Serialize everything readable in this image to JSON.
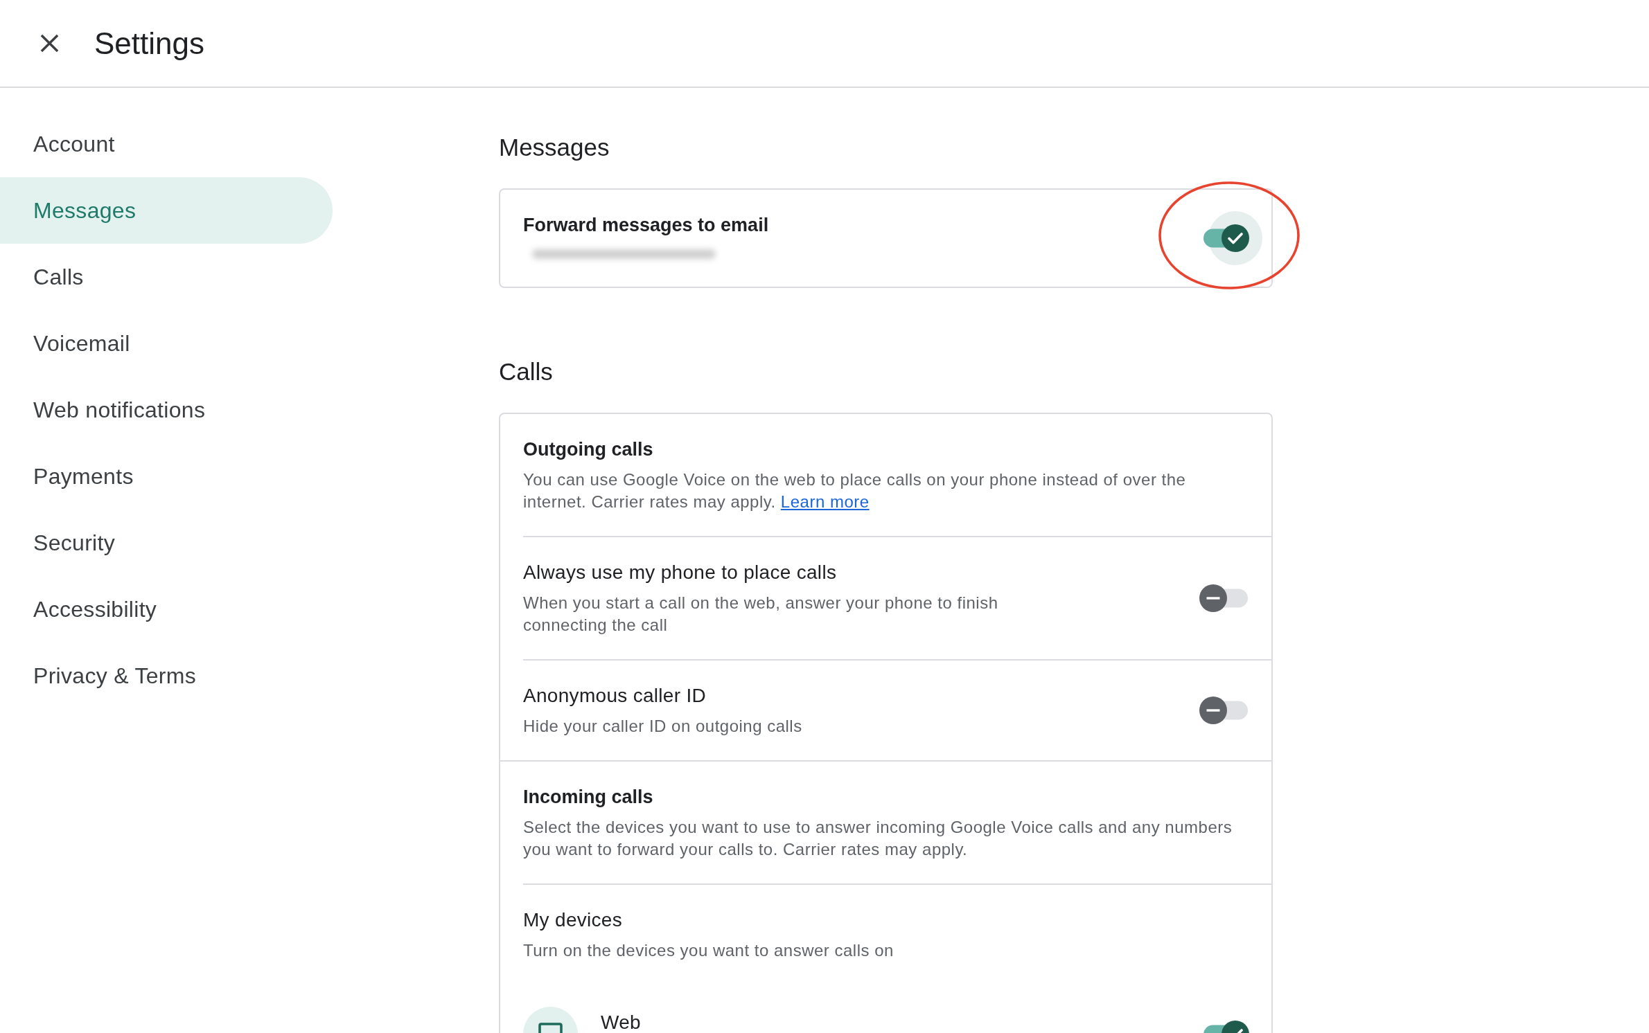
{
  "header": {
    "title": "Settings"
  },
  "sidebar": {
    "items": [
      {
        "label": "Account",
        "selected": false
      },
      {
        "label": "Messages",
        "selected": true
      },
      {
        "label": "Calls",
        "selected": false
      },
      {
        "label": "Voicemail",
        "selected": false
      },
      {
        "label": "Web notifications",
        "selected": false
      },
      {
        "label": "Payments",
        "selected": false
      },
      {
        "label": "Security",
        "selected": false
      },
      {
        "label": "Accessibility",
        "selected": false
      },
      {
        "label": "Privacy & Terms",
        "selected": false
      }
    ]
  },
  "sections": [
    {
      "heading": "Messages",
      "groups": [
        {
          "items": [
            {
              "kind": "primary",
              "title": "Forward messages to email",
              "detail_redacted": true,
              "on": true,
              "focused": true,
              "annotated": true
            }
          ]
        }
      ]
    },
    {
      "heading": "Calls",
      "groups": [
        {
          "items": [
            {
              "kind": "info",
              "title": "Outgoing calls",
              "description": "You can use Google Voice on the web to place calls on your phone instead of over the internet. Carrier rates may apply.",
              "link": "Learn more"
            },
            {
              "kind": "toggle",
              "title": "Always use my phone to place calls",
              "description": "When you start a call on the web, answer your phone to finish connecting the call",
              "on": false,
              "focused": false
            },
            {
              "kind": "toggle",
              "title": "Anonymous caller ID",
              "description": "Hide your caller ID on outgoing calls",
              "on": false,
              "focused": false
            }
          ]
        },
        {
          "items": [
            {
              "kind": "info",
              "title": "Incoming calls",
              "description": "Select the devices you want to use to answer incoming Google Voice calls and any numbers you want to forward your calls to. Carrier rates may apply."
            },
            {
              "kind": "subsection",
              "title": "My devices",
              "description": "Turn on the devices you want to answer calls on",
              "devices": [
                {
                  "label": "Web",
                  "on": true,
                  "focused": false
                }
              ]
            }
          ]
        }
      ]
    }
  ]
}
